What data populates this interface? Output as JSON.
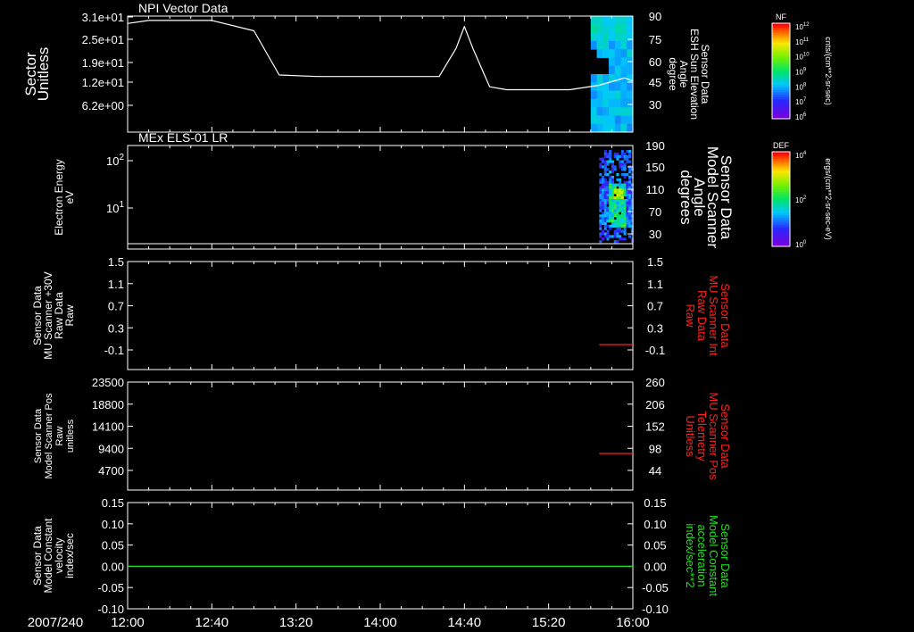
{
  "date_label": "2007/240",
  "time_ticks": [
    "12:00",
    "12:40",
    "13:20",
    "14:00",
    "14:40",
    "15:20",
    "16:00"
  ],
  "panels": [
    {
      "title": "NPI Vector Data",
      "left_label": [
        "Sector",
        "Unitless"
      ],
      "left_ticks": [
        "3.1e+01",
        "2.5e+01",
        "1.9e+01",
        "1.2e+01",
        "6.2e+00"
      ],
      "right_label": [
        "Sensor Data",
        "ESH Sun Elevation",
        "Angle",
        "degree"
      ],
      "right_ticks": [
        "90",
        "75",
        "60",
        "45",
        "30"
      ],
      "right_color": "#ffffff"
    },
    {
      "title": "MEx ELS-01 LR",
      "left_label": [
        "Electron Energy",
        "eV"
      ],
      "left_ticks": [
        "10",
        "10"
      ],
      "left_exps": [
        "2",
        "1"
      ],
      "right_label": [
        "Sensor Data",
        "Model Scanner",
        "Angle",
        "degrees"
      ],
      "right_ticks": [
        "190",
        "150",
        "110",
        "70",
        "30"
      ],
      "right_color": "#ffffff"
    },
    {
      "title": "",
      "left_label": [
        "Sensor Data",
        "MU Scanner +30V",
        "Raw Data",
        "Raw"
      ],
      "left_ticks": [
        "1.5",
        "1.1",
        "0.7",
        "0.3",
        "-0.1"
      ],
      "right_label": [
        "Sensor Data",
        "MU Scanner Int",
        "Raw Data",
        "Raw"
      ],
      "right_ticks": [
        "1.5",
        "1.1",
        "0.7",
        "0.3",
        "-0.1"
      ],
      "right_color": "#ff2020"
    },
    {
      "title": "",
      "left_label": [
        "Sensor Data",
        "Model Scanner Pos",
        "Raw",
        "unitless"
      ],
      "left_ticks": [
        "23500",
        "18800",
        "14100",
        "9400",
        "4700"
      ],
      "right_label": [
        "Sensor Data",
        "MU Scanner Pos",
        "Telemetry",
        "Unitless"
      ],
      "right_ticks": [
        "260",
        "206",
        "152",
        "98",
        "44"
      ],
      "right_color": "#ff2020"
    },
    {
      "title": "",
      "left_label": [
        "Sensor Data",
        "Model Constant",
        "velocity",
        "index/sec"
      ],
      "left_ticks": [
        "0.15",
        "0.10",
        "0.05",
        "0.00",
        "-0.05",
        "-0.10"
      ],
      "right_label": [
        "Sensor Data",
        "Model Constant",
        "acceleration",
        "index/sec**2"
      ],
      "right_ticks": [
        "0.15",
        "0.10",
        "0.05",
        "0.00",
        "-0.05",
        "-0.10"
      ],
      "right_color": "#20e020"
    }
  ],
  "colorbars": [
    {
      "tag": "NF",
      "label": "cnts/(cm**2-sr-sec)",
      "ticks": [
        "10",
        "10",
        "10",
        "10",
        "10",
        "10",
        "10"
      ],
      "exps": [
        "12",
        "11",
        "10",
        "9",
        "8",
        "7",
        "6"
      ]
    },
    {
      "tag": "DEF",
      "label": "ergs/(cm**2-sr-sec-eV)",
      "ticks": [
        "10",
        "10",
        "10"
      ],
      "exps": [
        "4",
        "2",
        "0"
      ]
    }
  ],
  "chart_data": [
    {
      "type": "line",
      "title": "NPI Vector Data",
      "series": [
        {
          "name": "Sensor Data ESH Sun Elevation Angle",
          "x": [
            "12:00",
            "12:10",
            "12:40",
            "13:00",
            "13:12",
            "13:30",
            "14:00",
            "14:28",
            "14:36",
            "14:40",
            "14:44",
            "14:52",
            "15:00",
            "15:30",
            "15:44",
            "15:56",
            "16:00"
          ],
          "values": [
            85,
            87,
            87,
            80,
            50,
            49,
            49,
            49,
            68,
            83,
            68,
            42,
            40,
            40,
            43,
            48,
            46
          ]
        }
      ],
      "ylim": [
        15,
        95
      ],
      "spectrogram_start": "15:40"
    },
    {
      "type": "heatmap",
      "title": "MEx ELS-01 LR",
      "xlabel": "",
      "ylabel": "Electron Energy eV",
      "data_start": "15:44",
      "data_end": "15:56"
    },
    {
      "type": "line",
      "series": [
        {
          "name": "Sensor Data MU Scanner Int Raw Data Raw",
          "x": [
            "15:44",
            "16:00"
          ],
          "values": [
            0.0,
            0.0
          ]
        }
      ],
      "ylim": [
        -0.3,
        1.5
      ]
    },
    {
      "type": "line",
      "series": [
        {
          "name": "Sensor Data MU Scanner Pos Telemetry Unitless",
          "x": [
            "15:44",
            "16:00"
          ],
          "values": [
            80,
            80
          ]
        }
      ],
      "ylim": [
        0,
        260
      ]
    },
    {
      "type": "line",
      "series": [
        {
          "name": "Sensor Data Model Constant acceleration index/sec**2",
          "x": [
            "12:00",
            "16:00"
          ],
          "values": [
            0.0,
            0.0
          ]
        }
      ],
      "ylim": [
        -0.1,
        0.15
      ]
    }
  ]
}
